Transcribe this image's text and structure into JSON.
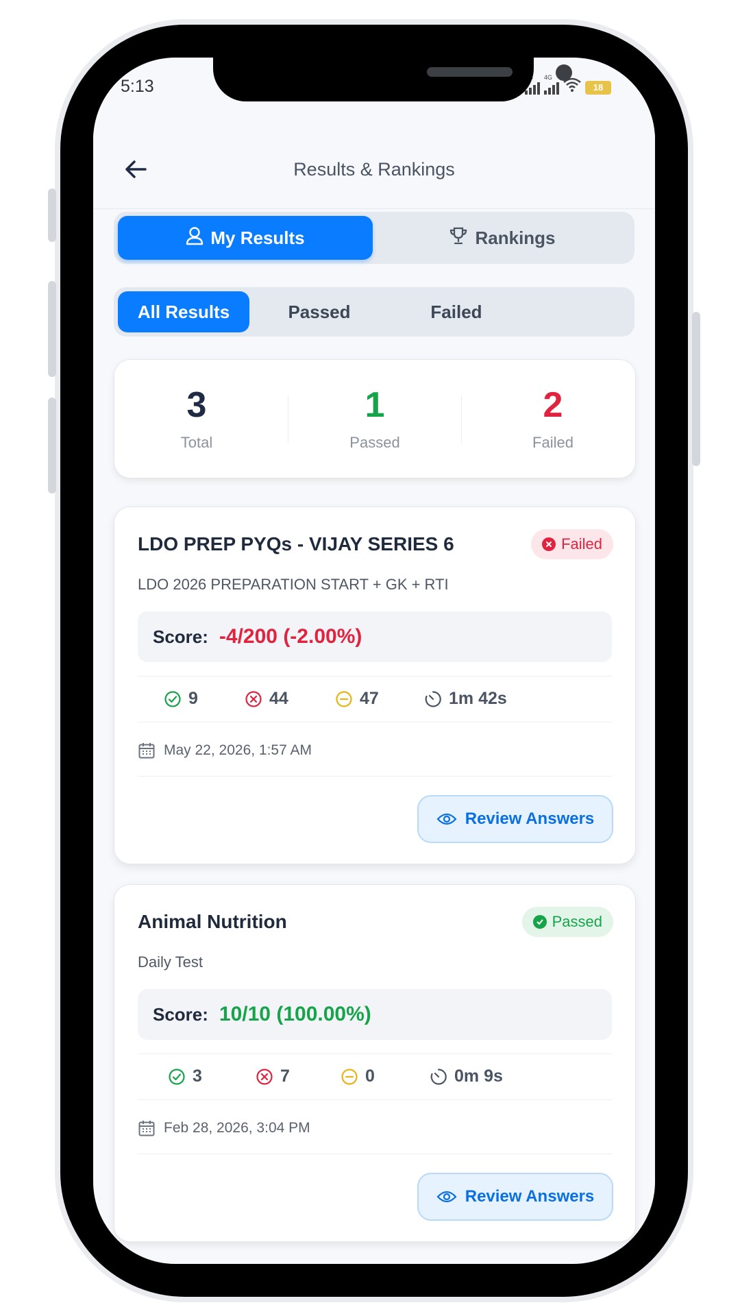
{
  "status_bar": {
    "time": "5:13",
    "network_1": "4G",
    "network_2": "4G",
    "battery": "18"
  },
  "header": {
    "title": "Results & Rankings"
  },
  "main_tabs": [
    {
      "label": "My Results",
      "icon": "user-icon",
      "active": true
    },
    {
      "label": "Rankings",
      "icon": "trophy-icon",
      "active": false
    }
  ],
  "filter_tabs": [
    {
      "label": "All Results",
      "active": true
    },
    {
      "label": "Passed",
      "active": false
    },
    {
      "label": "Failed",
      "active": false
    }
  ],
  "summary": {
    "total": {
      "value": "3",
      "label": "Total",
      "color": "#1f2a44"
    },
    "passed": {
      "value": "1",
      "label": "Passed",
      "color": "#17a34a"
    },
    "failed": {
      "value": "2",
      "label": "Failed",
      "color": "#e0233f"
    }
  },
  "results": [
    {
      "title": "LDO PREP PYQs - VIJAY SERIES 6",
      "status": "Failed",
      "subtitle": "LDO 2026 PREPARATION START + GK + RTI",
      "score_label": "Score:",
      "score": "-4/200 (-2.00%)",
      "score_color": "#e0233f",
      "correct": "9",
      "wrong": "44",
      "skipped": "47",
      "time": "1m 42s",
      "date": "May 22, 2026, 1:57 AM",
      "button": "Review Answers"
    },
    {
      "title": "Animal Nutrition",
      "status": "Passed",
      "subtitle": "Daily Test",
      "score_label": "Score:",
      "score": "10/10 (100.00%)",
      "score_color": "#17a34a",
      "correct": "3",
      "wrong": "7",
      "skipped": "0",
      "time": "0m 9s",
      "date": "Feb 28, 2026, 3:04 PM",
      "button": "Review Answers"
    }
  ],
  "colors": {
    "primary": "#0a7cff",
    "success": "#17a34a",
    "danger": "#e0233f",
    "warning": "#e8b414"
  }
}
